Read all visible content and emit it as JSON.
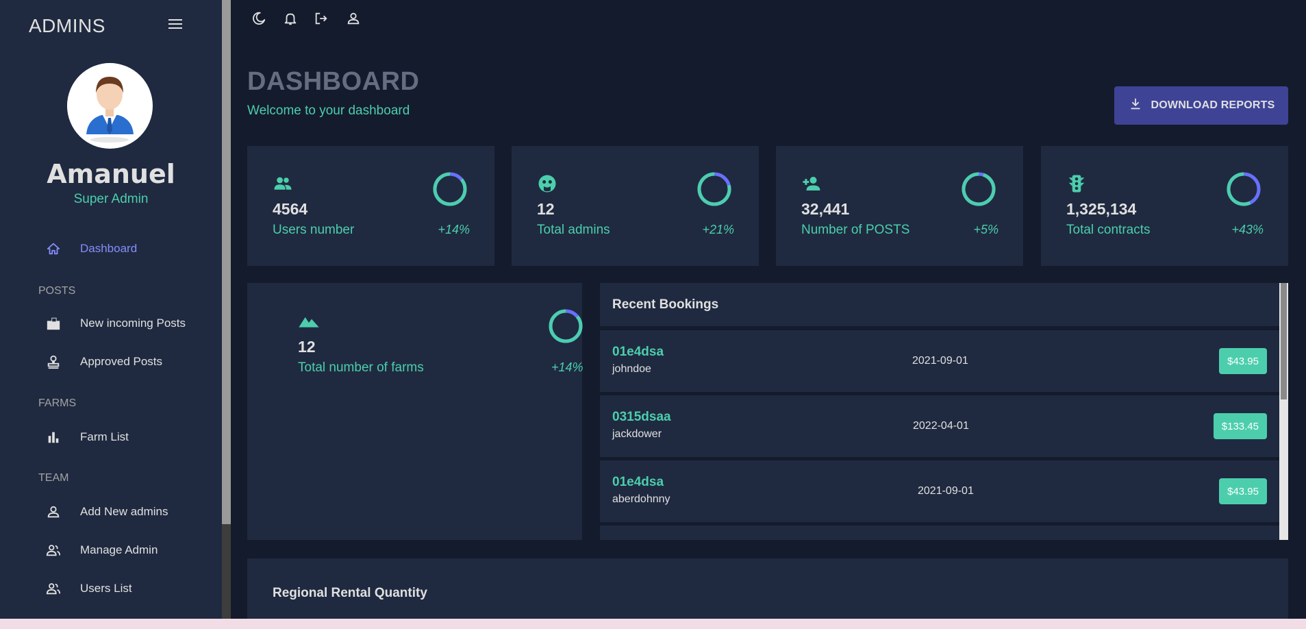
{
  "sidebar": {
    "brand": "ADMINS",
    "user_name": "Amanuel",
    "user_role": "Super Admin",
    "dashboard_label": "Dashboard",
    "sections": {
      "posts": "POSTS",
      "farms": "FARMS",
      "team": "TEAM"
    },
    "items": {
      "new_posts": "New incoming Posts",
      "approved_posts": "Approved Posts",
      "farm_list": "Farm List",
      "add_admins": "Add New admins",
      "manage_admin": "Manage Admin",
      "users_list": "Users List"
    }
  },
  "header": {
    "title": "DASHBOARD",
    "subtitle": "Welcome to your dashboard",
    "download_label": "DOWNLOAD REPORTS"
  },
  "stats": [
    {
      "value": "4564",
      "label": "Users number",
      "pct": "+14%",
      "progress": 0.14,
      "icon": "people-icon"
    },
    {
      "value": "12",
      "label": "Total admins",
      "pct": "+21%",
      "progress": 0.21,
      "icon": "admin-face-icon"
    },
    {
      "value": "32,441",
      "label": "Number of POSTS",
      "pct": "+5%",
      "progress": 0.05,
      "icon": "person-add-icon"
    },
    {
      "value": "1,325,134",
      "label": "Total contracts",
      "pct": "+43%",
      "progress": 0.43,
      "icon": "traffic-icon"
    }
  ],
  "farms": {
    "value": "12",
    "label": "Total number of farms",
    "pct": "+14%",
    "progress": 0.14,
    "icon": "terrain-icon"
  },
  "bookings": {
    "title": "Recent Bookings",
    "rows": [
      {
        "tx": "01e4dsa",
        "user": "johndoe",
        "date": "2021-09-01",
        "cost": "$43.95"
      },
      {
        "tx": "0315dsaa",
        "user": "jackdower",
        "date": "2022-04-01",
        "cost": "$133.45"
      },
      {
        "tx": "01e4dsa",
        "user": "aberdohnny",
        "date": "2021-09-01",
        "cost": "$43.95"
      }
    ]
  },
  "regional": {
    "title": "Regional Rental Quantity"
  },
  "colors": {
    "accent": "#4cceac",
    "brand_blue": "#3e4396",
    "ring_blue": "#6870fa",
    "panel": "#1f2a40",
    "bg": "#141b2d"
  }
}
